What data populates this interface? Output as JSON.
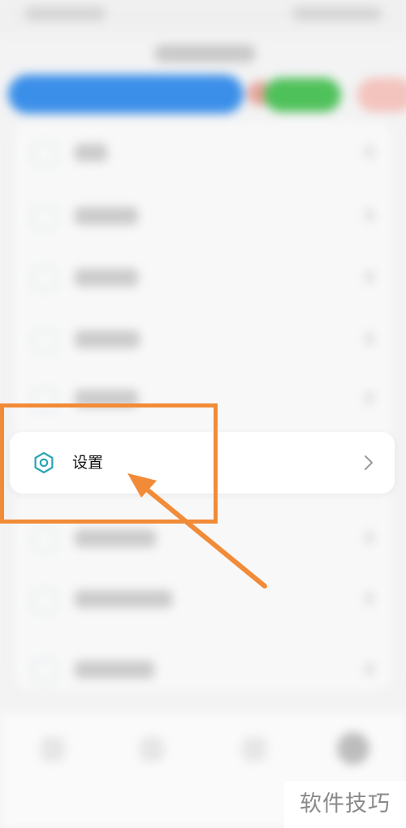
{
  "settings_item": {
    "label": "设置",
    "icon": "hexagon-settings-icon",
    "accent_color": "#2aa4b5",
    "chevron_icon": "chevron-right-icon"
  },
  "annotation": {
    "highlight_color": "#f28b38",
    "arrow_icon": "arrow-pointer-icon"
  },
  "watermark": {
    "text": "软件技巧"
  }
}
